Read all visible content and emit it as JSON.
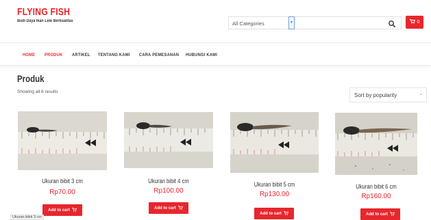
{
  "header": {
    "logo_title": "FLYING FISH",
    "logo_tagline": "Budi Daya Ikan Lele Berkualitas",
    "category_select": "All Categories",
    "cart_count": "0",
    "icons": {
      "search": "search-icon",
      "cart": "cart-icon"
    }
  },
  "nav": {
    "items": [
      {
        "label": "HOME",
        "active": true
      },
      {
        "label": "PRODUK",
        "active": true
      },
      {
        "label": "ARTIKEL",
        "active": false
      },
      {
        "label": "TENTANG KAMI",
        "active": false
      },
      {
        "label": "CARA PEMESANAN",
        "active": false
      },
      {
        "label": "HUBUNGI KAMI",
        "active": false
      }
    ]
  },
  "main": {
    "title": "Produk",
    "result_count": "Showing all 6 results",
    "sort_select": "Sort by popularity"
  },
  "products": [
    {
      "name": "Ukuran bibit 3 cm",
      "price": "Rp70.00",
      "button": "Add to cart"
    },
    {
      "name": "Ukuran bibit 4 cm",
      "price": "Rp100.00",
      "button": "Add to cart"
    },
    {
      "name": "Ukuran bibit 5 cm",
      "price": "Rp130.00",
      "button": "Add to cart"
    },
    {
      "name": "Ukuran bibit 6 cm",
      "price": "Rp160.00",
      "button": "Add to cart"
    }
  ],
  "status_bar": "Ukuran bibit 3 cm",
  "colors": {
    "accent": "#e8262d",
    "text": "#333333",
    "ruler": "#e9e6df"
  }
}
